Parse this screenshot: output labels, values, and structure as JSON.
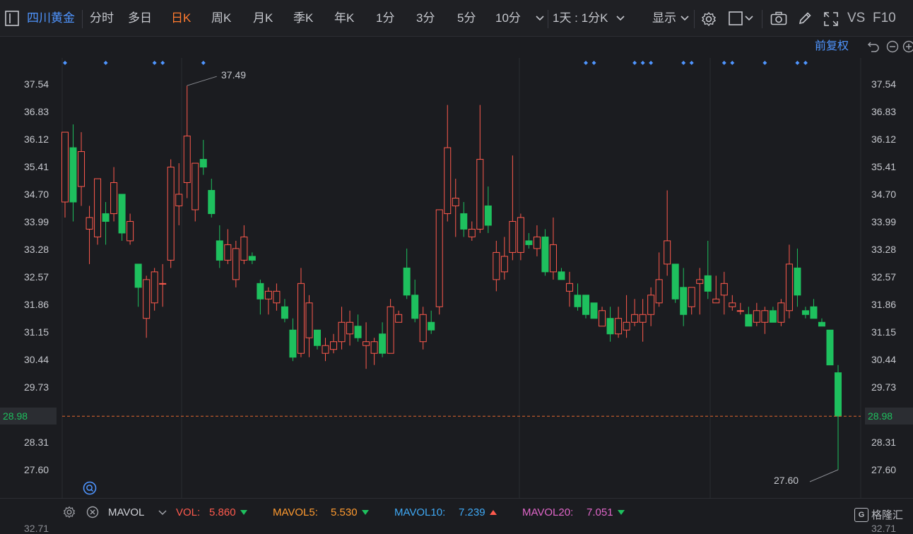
{
  "stock": {
    "name": "四川黄金"
  },
  "toolbar": {
    "tabs": [
      "分时",
      "多日",
      "日K",
      "周K",
      "月K",
      "季K",
      "年K",
      "1分",
      "3分",
      "5分",
      "10分"
    ],
    "active_tab": "日K",
    "multi_period": "1天 : 1分K",
    "display_label": "显示",
    "vs_label": "VS",
    "f10_label": "F10"
  },
  "subbar": {
    "adjust_label": "前复权"
  },
  "colors": {
    "up": "#ff5a4d",
    "down": "#1ec05e",
    "bg": "#1b1c20",
    "accent": "#ff7a2f",
    "blue": "#4f95ff"
  },
  "y_axis": {
    "ticks": [
      "37.54",
      "36.83",
      "36.12",
      "35.41",
      "34.70",
      "33.99",
      "33.28",
      "32.57",
      "31.86",
      "31.15",
      "30.44",
      "29.73",
      "28.98",
      "28.31",
      "27.60"
    ],
    "current_price": "28.98",
    "bottom_cut_left": "32.71",
    "bottom_cut_right": "32.71"
  },
  "annotations": {
    "high": "37.49",
    "low": "27.60"
  },
  "chart_data": {
    "type": "candlestick",
    "ylim": [
      27.3,
      38.0
    ],
    "candles": [
      {
        "o": 34.5,
        "h": 35.5,
        "l": 34.1,
        "c": 36.3
      },
      {
        "o": 35.9,
        "h": 36.5,
        "l": 34.0,
        "c": 34.5
      },
      {
        "o": 34.9,
        "h": 36.3,
        "l": 34.4,
        "c": 35.8
      },
      {
        "o": 33.8,
        "h": 34.4,
        "l": 32.9,
        "c": 34.1
      },
      {
        "o": 33.6,
        "h": 34.6,
        "l": 33.4,
        "c": 35.1
      },
      {
        "o": 34.2,
        "h": 34.5,
        "l": 33.4,
        "c": 34.0
      },
      {
        "o": 34.2,
        "h": 35.4,
        "l": 34.0,
        "c": 35.0
      },
      {
        "o": 34.7,
        "h": 34.7,
        "l": 33.5,
        "c": 33.7
      },
      {
        "o": 33.5,
        "h": 34.2,
        "l": 33.4,
        "c": 34.0
      },
      {
        "o": 32.9,
        "h": 32.9,
        "l": 31.8,
        "c": 32.3
      },
      {
        "o": 31.5,
        "h": 32.6,
        "l": 31.0,
        "c": 32.5
      },
      {
        "o": 31.9,
        "h": 32.8,
        "l": 31.7,
        "c": 32.7
      },
      {
        "o": 32.4,
        "h": 32.9,
        "l": 31.8,
        "c": 32.4
      },
      {
        "o": 33.0,
        "h": 35.6,
        "l": 32.8,
        "c": 35.4
      },
      {
        "o": 34.4,
        "h": 35.5,
        "l": 33.9,
        "c": 34.7
      },
      {
        "o": 35.0,
        "h": 37.5,
        "l": 34.6,
        "c": 36.2
      },
      {
        "o": 34.3,
        "h": 35.3,
        "l": 34.0,
        "c": 35.5
      },
      {
        "o": 35.6,
        "h": 36.1,
        "l": 35.2,
        "c": 35.4
      },
      {
        "o": 34.8,
        "h": 35.1,
        "l": 34.1,
        "c": 34.2
      },
      {
        "o": 33.5,
        "h": 33.9,
        "l": 32.8,
        "c": 33.0
      },
      {
        "o": 33.0,
        "h": 33.8,
        "l": 32.9,
        "c": 33.4
      },
      {
        "o": 32.5,
        "h": 33.5,
        "l": 32.3,
        "c": 33.3
      },
      {
        "o": 33.0,
        "h": 33.9,
        "l": 32.9,
        "c": 33.6
      },
      {
        "o": 33.1,
        "h": 33.2,
        "l": 32.9,
        "c": 33.0
      },
      {
        "o": 32.4,
        "h": 32.5,
        "l": 31.6,
        "c": 32.0
      },
      {
        "o": 32.0,
        "h": 32.3,
        "l": 31.6,
        "c": 32.2
      },
      {
        "o": 31.9,
        "h": 32.4,
        "l": 31.7,
        "c": 32.2
      },
      {
        "o": 31.8,
        "h": 32.0,
        "l": 31.4,
        "c": 31.5
      },
      {
        "o": 31.2,
        "h": 31.5,
        "l": 30.4,
        "c": 30.5
      },
      {
        "o": 30.6,
        "h": 32.8,
        "l": 30.5,
        "c": 32.4
      },
      {
        "o": 31.0,
        "h": 32.1,
        "l": 30.5,
        "c": 31.9
      },
      {
        "o": 31.2,
        "h": 31.1,
        "l": 30.7,
        "c": 30.8
      },
      {
        "o": 30.6,
        "h": 31.0,
        "l": 30.4,
        "c": 30.8
      },
      {
        "o": 30.7,
        "h": 31.1,
        "l": 30.6,
        "c": 30.9
      },
      {
        "o": 30.9,
        "h": 31.8,
        "l": 30.7,
        "c": 31.4
      },
      {
        "o": 31.1,
        "h": 31.7,
        "l": 30.8,
        "c": 31.4
      },
      {
        "o": 31.3,
        "h": 31.6,
        "l": 30.9,
        "c": 31.0
      },
      {
        "o": 30.8,
        "h": 31.4,
        "l": 30.2,
        "c": 30.9
      },
      {
        "o": 30.6,
        "h": 31.0,
        "l": 30.3,
        "c": 30.9
      },
      {
        "o": 31.1,
        "h": 31.4,
        "l": 30.5,
        "c": 30.6
      },
      {
        "o": 30.6,
        "h": 32.0,
        "l": 30.6,
        "c": 31.8
      },
      {
        "o": 31.4,
        "h": 31.7,
        "l": 31.4,
        "c": 31.6
      },
      {
        "o": 32.8,
        "h": 33.3,
        "l": 32.0,
        "c": 32.1
      },
      {
        "o": 32.1,
        "h": 32.5,
        "l": 31.4,
        "c": 31.5
      },
      {
        "o": 30.9,
        "h": 31.8,
        "l": 30.7,
        "c": 31.6
      },
      {
        "o": 31.4,
        "h": 31.7,
        "l": 31.1,
        "c": 31.2
      },
      {
        "o": 31.8,
        "h": 34.3,
        "l": 31.6,
        "c": 34.3
      },
      {
        "o": 34.2,
        "h": 37.0,
        "l": 34.0,
        "c": 35.9
      },
      {
        "o": 34.4,
        "h": 35.1,
        "l": 33.6,
        "c": 34.6
      },
      {
        "o": 34.2,
        "h": 34.5,
        "l": 33.6,
        "c": 33.8
      },
      {
        "o": 33.6,
        "h": 34.0,
        "l": 33.5,
        "c": 33.8
      },
      {
        "o": 33.8,
        "h": 37.0,
        "l": 33.7,
        "c": 35.6
      },
      {
        "o": 34.4,
        "h": 34.9,
        "l": 33.7,
        "c": 33.9
      },
      {
        "o": 32.5,
        "h": 33.5,
        "l": 32.2,
        "c": 33.2
      },
      {
        "o": 32.7,
        "h": 33.6,
        "l": 32.5,
        "c": 33.1
      },
      {
        "o": 33.2,
        "h": 35.7,
        "l": 33.0,
        "c": 34.0
      },
      {
        "o": 33.2,
        "h": 34.2,
        "l": 33.0,
        "c": 34.1
      },
      {
        "o": 33.5,
        "h": 33.7,
        "l": 33.3,
        "c": 33.4
      },
      {
        "o": 33.3,
        "h": 33.9,
        "l": 33.1,
        "c": 33.6
      },
      {
        "o": 33.6,
        "h": 33.8,
        "l": 32.6,
        "c": 32.7
      },
      {
        "o": 32.7,
        "h": 34.1,
        "l": 32.5,
        "c": 33.4
      },
      {
        "o": 32.7,
        "h": 32.8,
        "l": 32.5,
        "c": 32.5
      },
      {
        "o": 32.2,
        "h": 32.7,
        "l": 31.8,
        "c": 32.4
      },
      {
        "o": 32.1,
        "h": 32.4,
        "l": 31.7,
        "c": 31.8
      },
      {
        "o": 32.1,
        "h": 32.1,
        "l": 31.5,
        "c": 31.6
      },
      {
        "o": 31.9,
        "h": 31.9,
        "l": 31.5,
        "c": 31.5
      },
      {
        "o": 31.3,
        "h": 31.8,
        "l": 31.3,
        "c": 31.7
      },
      {
        "o": 31.5,
        "h": 31.8,
        "l": 30.9,
        "c": 31.1
      },
      {
        "o": 31.1,
        "h": 31.8,
        "l": 31.0,
        "c": 31.5
      },
      {
        "o": 31.2,
        "h": 32.1,
        "l": 31.0,
        "c": 31.4
      },
      {
        "o": 31.4,
        "h": 32.0,
        "l": 31.3,
        "c": 31.6
      },
      {
        "o": 31.4,
        "h": 32.0,
        "l": 30.9,
        "c": 31.6
      },
      {
        "o": 31.6,
        "h": 32.3,
        "l": 31.3,
        "c": 32.1
      },
      {
        "o": 31.9,
        "h": 33.2,
        "l": 31.8,
        "c": 32.5
      },
      {
        "o": 32.9,
        "h": 34.8,
        "l": 32.6,
        "c": 33.5
      },
      {
        "o": 32.9,
        "h": 32.8,
        "l": 31.9,
        "c": 32.0
      },
      {
        "o": 32.3,
        "h": 32.8,
        "l": 31.3,
        "c": 31.6
      },
      {
        "o": 31.8,
        "h": 32.2,
        "l": 31.6,
        "c": 32.3
      },
      {
        "o": 32.4,
        "h": 32.8,
        "l": 31.6,
        "c": 32.5
      },
      {
        "o": 32.6,
        "h": 33.5,
        "l": 32.0,
        "c": 32.2
      },
      {
        "o": 31.9,
        "h": 32.6,
        "l": 31.9,
        "c": 32.0
      },
      {
        "o": 32.1,
        "h": 32.7,
        "l": 31.6,
        "c": 32.4
      },
      {
        "o": 31.8,
        "h": 32.1,
        "l": 31.7,
        "c": 31.9
      },
      {
        "o": 31.7,
        "h": 31.9,
        "l": 31.6,
        "c": 31.7
      },
      {
        "o": 31.6,
        "h": 31.8,
        "l": 31.3,
        "c": 31.3
      },
      {
        "o": 31.4,
        "h": 31.9,
        "l": 31.3,
        "c": 31.7
      },
      {
        "o": 31.4,
        "h": 31.8,
        "l": 31.1,
        "c": 31.7
      },
      {
        "o": 31.7,
        "h": 31.8,
        "l": 31.4,
        "c": 31.4
      },
      {
        "o": 31.4,
        "h": 32.0,
        "l": 31.3,
        "c": 31.9
      },
      {
        "o": 31.7,
        "h": 33.4,
        "l": 31.5,
        "c": 32.9
      },
      {
        "o": 32.8,
        "h": 33.3,
        "l": 31.8,
        "c": 32.1
      },
      {
        "o": 31.7,
        "h": 31.8,
        "l": 31.5,
        "c": 31.6
      },
      {
        "o": 31.8,
        "h": 32.0,
        "l": 31.5,
        "c": 31.5
      },
      {
        "o": 31.4,
        "h": 31.5,
        "l": 31.3,
        "c": 31.3
      },
      {
        "o": 31.2,
        "h": 31.2,
        "l": 30.3,
        "c": 30.3
      },
      {
        "o": 30.1,
        "h": 30.3,
        "l": 27.6,
        "c": 28.98
      }
    ]
  },
  "volume": {
    "indicator": "MAVOL",
    "vol_label": "VOL:",
    "vol_value": "5.860",
    "mavol5_label": "MAVOL5:",
    "mavol5_value": "5.530",
    "mavol10_label": "MAVOL10:",
    "mavol10_value": "7.239",
    "mavol20_label": "MAVOL20:",
    "mavol20_value": "7.051"
  },
  "watermark": {
    "text": "格隆汇"
  }
}
